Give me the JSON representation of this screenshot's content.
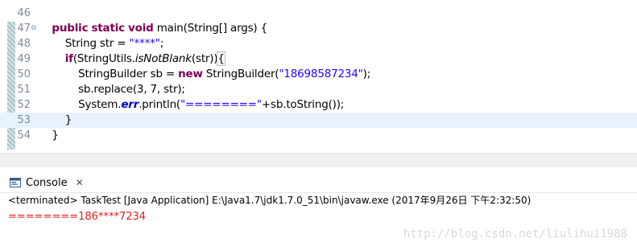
{
  "editor": {
    "lines": [
      {
        "num": "46",
        "parts": [
          {
            "t": "",
            "c": ""
          }
        ]
      },
      {
        "num": "47",
        "fold": "⊖",
        "parts": [
          {
            "t": "    ",
            "c": ""
          },
          {
            "t": "public",
            "c": "kw"
          },
          {
            "t": " ",
            "c": ""
          },
          {
            "t": "static",
            "c": "kw"
          },
          {
            "t": " ",
            "c": ""
          },
          {
            "t": "void",
            "c": "kw"
          },
          {
            "t": " main(String[] args) {",
            "c": ""
          }
        ]
      },
      {
        "num": "48",
        "parts": [
          {
            "t": "        String str = ",
            "c": ""
          },
          {
            "t": "\"****\"",
            "c": "str"
          },
          {
            "t": ";",
            "c": ""
          }
        ]
      },
      {
        "num": "49",
        "parts": [
          {
            "t": "        ",
            "c": ""
          },
          {
            "t": "if",
            "c": "kw"
          },
          {
            "t": "(StringUtils.",
            "c": ""
          },
          {
            "t": "isNotBlank",
            "c": "ital"
          },
          {
            "t": "(str))",
            "c": ""
          },
          {
            "t": "{",
            "c": "bracket-hl"
          }
        ]
      },
      {
        "num": "50",
        "parts": [
          {
            "t": "            StringBuilder sb = ",
            "c": ""
          },
          {
            "t": "new",
            "c": "kw"
          },
          {
            "t": " StringBuilder(",
            "c": ""
          },
          {
            "t": "\"18698587234\"",
            "c": "str"
          },
          {
            "t": ");",
            "c": ""
          }
        ]
      },
      {
        "num": "51",
        "parts": [
          {
            "t": "            sb.replace(3, 7, str);",
            "c": ""
          }
        ]
      },
      {
        "num": "52",
        "parts": [
          {
            "t": "            System.",
            "c": ""
          },
          {
            "t": "err",
            "c": "field"
          },
          {
            "t": ".println(",
            "c": ""
          },
          {
            "t": "\"========\"",
            "c": "str"
          },
          {
            "t": "+sb.toString());",
            "c": ""
          }
        ]
      },
      {
        "num": "53",
        "current": true,
        "parts": [
          {
            "t": "        }",
            "c": ""
          }
        ]
      },
      {
        "num": "54",
        "parts": [
          {
            "t": "    }",
            "c": ""
          }
        ]
      }
    ]
  },
  "console": {
    "tab_label": "Console",
    "close_glyph": "✕",
    "status": "<terminated> TaskTest [Java Application] E:\\Java1.7\\jdk1.7.0_51\\bin\\javaw.exe (2017年9月26日 下午2:32:50)",
    "output": "========186****7234"
  },
  "watermark": "http://blog.csdn.net/liulihui1988",
  "icons": {
    "console": "console-icon",
    "fold": "fold-collapse-icon"
  }
}
